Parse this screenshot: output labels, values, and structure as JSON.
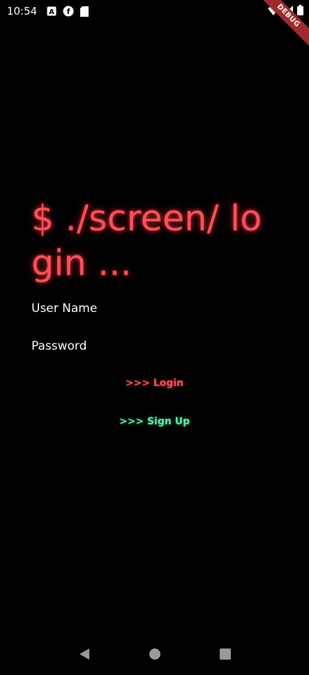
{
  "status_bar": {
    "time": "10:54",
    "icons": [
      "a-icon",
      "f-icon",
      "sd-card-icon"
    ],
    "right_icons": [
      "wifi-icon",
      "signal-icon",
      "battery-icon"
    ]
  },
  "debug_banner": "DEBUG",
  "login": {
    "title": "$ ./screen/ login ...",
    "username_placeholder": "User Name",
    "password_placeholder": "Password",
    "login_label": ">>> Login",
    "signup_label": ">>> Sign Up"
  },
  "colors": {
    "background": "#000000",
    "accent_red": "#ff4f57",
    "accent_green": "#5cf0a2",
    "text": "#ffffff"
  },
  "nav_bar": {
    "icons": [
      "back-icon",
      "home-icon",
      "recents-icon"
    ]
  }
}
